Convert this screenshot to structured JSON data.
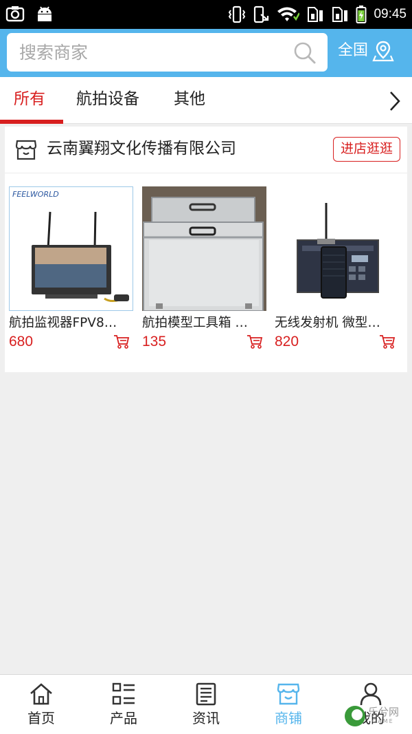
{
  "status_bar": {
    "time": "09:45"
  },
  "header": {
    "search_placeholder": "搜索商家",
    "region_label": "全国"
  },
  "tabs": [
    {
      "label": "所有"
    },
    {
      "label": "航拍设备"
    },
    {
      "label": "其他"
    }
  ],
  "shop": {
    "name": "云南翼翔文化传播有限公司",
    "visit_label": "进店逛逛",
    "products": [
      {
        "name": "航拍监视器FPV8…",
        "price": "680",
        "brand": "FEELWORLD"
      },
      {
        "name": "航拍模型工具箱 …",
        "price": "135"
      },
      {
        "name": "无线发射机 微型…",
        "price": "820"
      }
    ]
  },
  "bottom_nav": [
    {
      "label": "首页",
      "icon": "home-icon"
    },
    {
      "label": "产品",
      "icon": "list-icon"
    },
    {
      "label": "资讯",
      "icon": "news-icon"
    },
    {
      "label": "商铺",
      "icon": "shop-icon"
    },
    {
      "label": "我的",
      "icon": "user-icon"
    }
  ],
  "watermark": {
    "text": "乐兮网",
    "sub": "GAME"
  },
  "colors": {
    "accent": "#55b5ec",
    "highlight": "#d81f1f",
    "background": "#efefef"
  }
}
